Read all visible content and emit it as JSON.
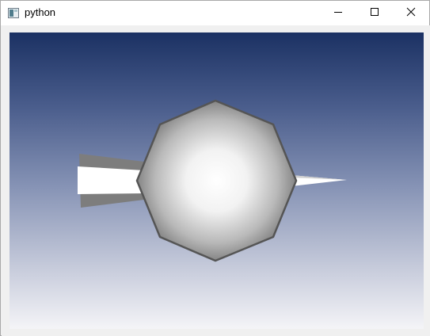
{
  "window": {
    "title": "python",
    "icons": {
      "app": "python-app-icon",
      "minimize": "minimize-icon",
      "maximize": "maximize-icon",
      "close": "close-icon"
    }
  },
  "scene": {
    "background_top": "#1b3163",
    "background_bottom": "#f4f4f7",
    "objects": [
      "cone-left",
      "octagon-sphere",
      "cone-right"
    ]
  }
}
